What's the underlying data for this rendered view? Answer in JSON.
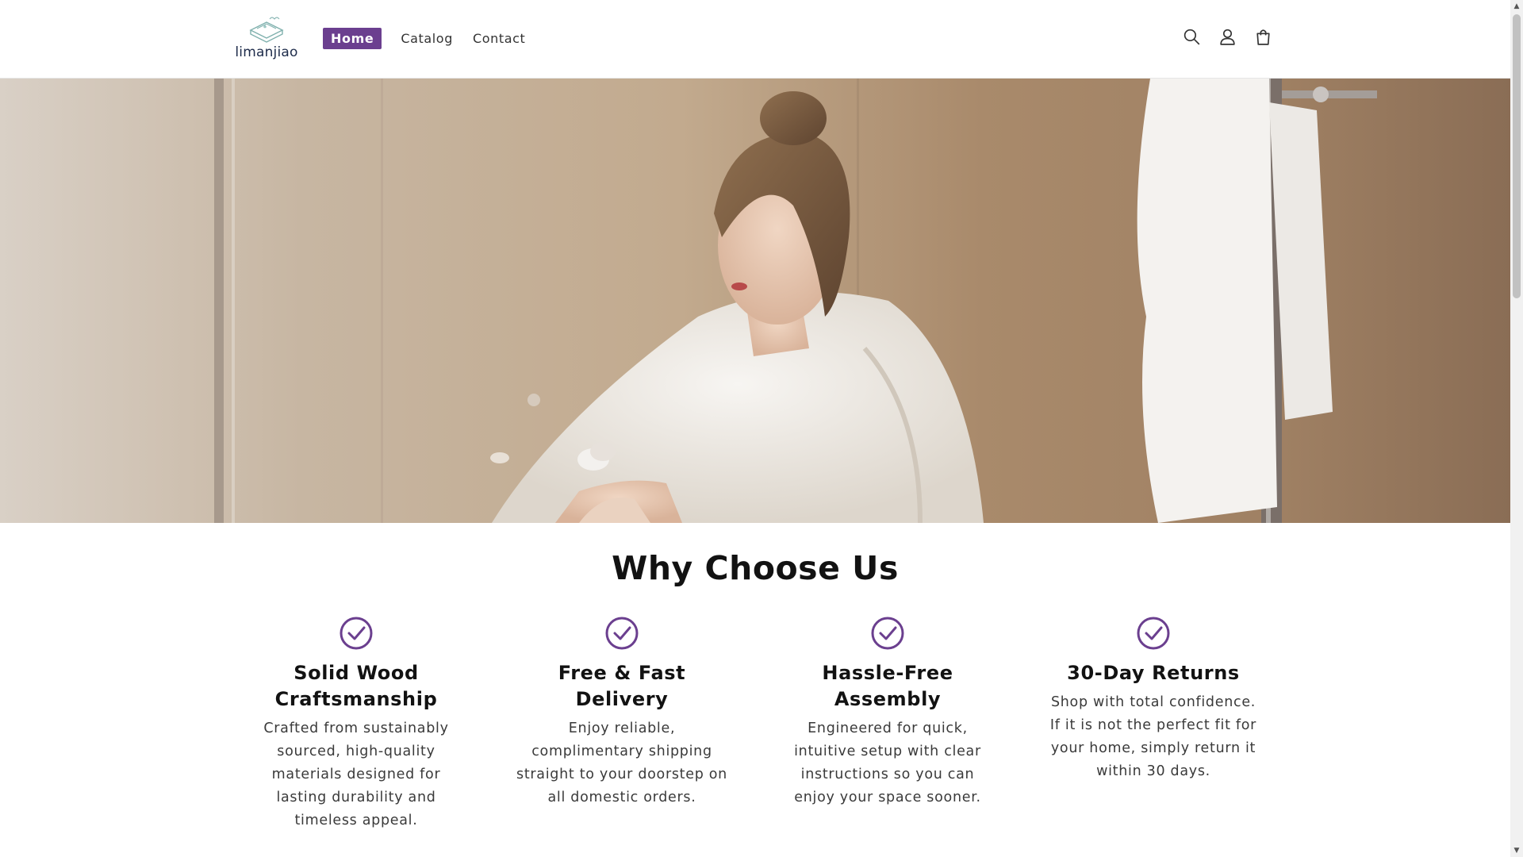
{
  "header": {
    "logo_text": "limanjiao",
    "nav": [
      {
        "label": "Home",
        "active": true
      },
      {
        "label": "Catalog",
        "active": false
      },
      {
        "label": "Contact",
        "active": false
      }
    ],
    "icons": [
      "search-icon",
      "account-icon",
      "cart-icon"
    ]
  },
  "hero": {
    "image": "woman-in-white-bathrobe-in-bathroom"
  },
  "why": {
    "title": "Why Choose Us",
    "features": [
      {
        "title": "Solid Wood Craftsmanship",
        "text": "Crafted from sustainably sourced, high-quality materials designed for lasting durability and timeless appeal.",
        "icon": "check-circle-icon"
      },
      {
        "title": "Free & Fast Delivery",
        "text": "Enjoy reliable, complimentary shipping straight to your doorstep on all domestic orders.",
        "icon": "check-circle-icon"
      },
      {
        "title": "Hassle-Free Assembly",
        "text": "Engineered for quick, intuitive setup with clear instructions so you can enjoy your space sooner.",
        "icon": "check-circle-icon"
      },
      {
        "title": "30-Day Returns",
        "text": "Shop with total confidence. If it is not the perfect fit for your home, simply return it within 30 days.",
        "icon": "check-circle-icon"
      }
    ]
  },
  "colors": {
    "accent": "#6b3f8f",
    "text": "#121212"
  }
}
